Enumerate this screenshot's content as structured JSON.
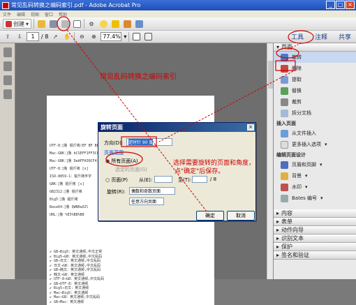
{
  "window": {
    "title": "常见乱码转换之编码索引.pdf - Adobe Acrobat Pro"
  },
  "menu": [
    "文件",
    "编辑",
    "视图",
    "窗口",
    "帮助"
  ],
  "toolbar": {
    "create_label": "创建"
  },
  "nav": {
    "page": "1",
    "total": "/ 8",
    "zoom": "77.4%"
  },
  "right_tabs": {
    "tools": "工具",
    "comment": "注释",
    "share": "共享"
  },
  "pages_panel": {
    "header": "页面",
    "items": [
      "旋转",
      "删除",
      "提取",
      "替换",
      "裁剪",
      "拆分文档"
    ],
    "insert_header": "插入页面",
    "insert_items": [
      "从文件插入",
      "更多插入选项"
    ],
    "design_header": "编辑页面设计",
    "design_items": [
      "页眉和页脚",
      "背景",
      "水印",
      "Bates 编号"
    ],
    "sections": [
      "内容",
      "表单",
      "动作向导",
      "识别文本",
      "保护",
      "签名和验证"
    ]
  },
  "document": {
    "title": "常见乱码转换之编码索引",
    "lines": [
      "UTF-8：]鲁 锟斤拷(EF BF BD)Adobe;AMr丰6;英文通频",
      "Mac-GBK：]鲁 bCSEFF1FF3CC56;英文通频",
      "Mac-GBK：]鲁 DeAFFA30CF4;英文通频",
      "UTF-8：]鲁 锟斤拷 [s]",
      "ISO-8859-1：锟斤拷丰字",
      "GBK：]鲁 锟斤拷 [s]",
      "GB2312：]鲁 锟斤拷",
      "Big5：]鲁 錕斤拷",
      "Base64：]鲁 QWN0aXZl",
      "URL：]鲁 %E5%B8%B8"
    ],
    "lower_lines": [
      "GB→Big5：英文通频,中文正常",
      "Big5→GB：英文通频,中文乱码",
      "GB→日文：英文通频,中文乱码",
      "日文→GB：英文通频,中文乱码",
      "GB→韩文：英文通频,中文乱码",
      "韩文→GB：英文通频",
      "UTF-8→GB：英文通频,中文乱码",
      "GB→UTF-8：英文通频",
      "Big5→日文：英文通频",
      "Mac→Big5：英文通频",
      "Mac→GB：英文通频,中文乱码",
      "GB→Mac：英文通频"
    ]
  },
  "dialog": {
    "title": "旋转页面",
    "direction_label": "方向(D):",
    "direction_value": "逆时针 90 度",
    "pages_group": "页面范围",
    "all_pages": "所有页面(A)",
    "selection": "选定的页面(G)",
    "pages_from": "页面(P)",
    "from": "从(E):",
    "to": "至(T):",
    "total": "/ 8",
    "rotate_label": "旋转(R):",
    "rotate_value": "偶数和奇数页面",
    "orient_value": "任意方向页面",
    "ok": "确定",
    "cancel": "取消"
  },
  "annotation": {
    "line1": "选择需要旋转的页面和角度，",
    "line2": "点\"确定\"后保存。"
  },
  "colors": {
    "annotation_red": "#d00000",
    "title_blue": "#1f4fb5"
  }
}
